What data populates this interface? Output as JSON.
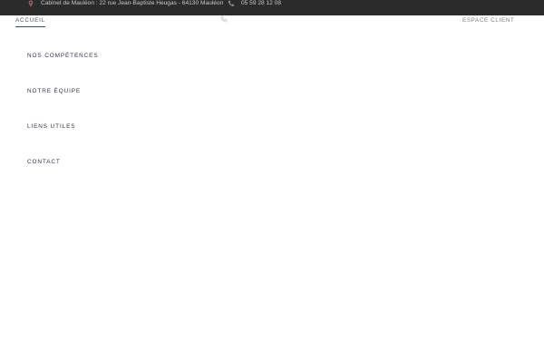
{
  "topbar": {
    "address_icon": "map-pin-icon",
    "address": "Cabinet de Mauléon : 22 rue Jean-Baptiste Heugas - 64130 Mauléon",
    "phone_icon": "phone-icon",
    "phone": "05 59 28 12 08",
    "background": "#2b2b2b",
    "text_color": "#c9c9c9",
    "icon_color": "#8e5a5a"
  },
  "header": {
    "active_nav": "ACCUEIL",
    "phone_icon": "phone-icon",
    "espace_client": "ESPACE CLIENT",
    "accent": "#2c4e86"
  },
  "menu": {
    "items": [
      {
        "label": "NOS COMPÉTENCES"
      },
      {
        "label": "NOTRE ÉQUIPE"
      },
      {
        "label": "LIENS UTILES"
      },
      {
        "label": "CONTACT"
      }
    ],
    "text_color": "#2e3a4c"
  }
}
